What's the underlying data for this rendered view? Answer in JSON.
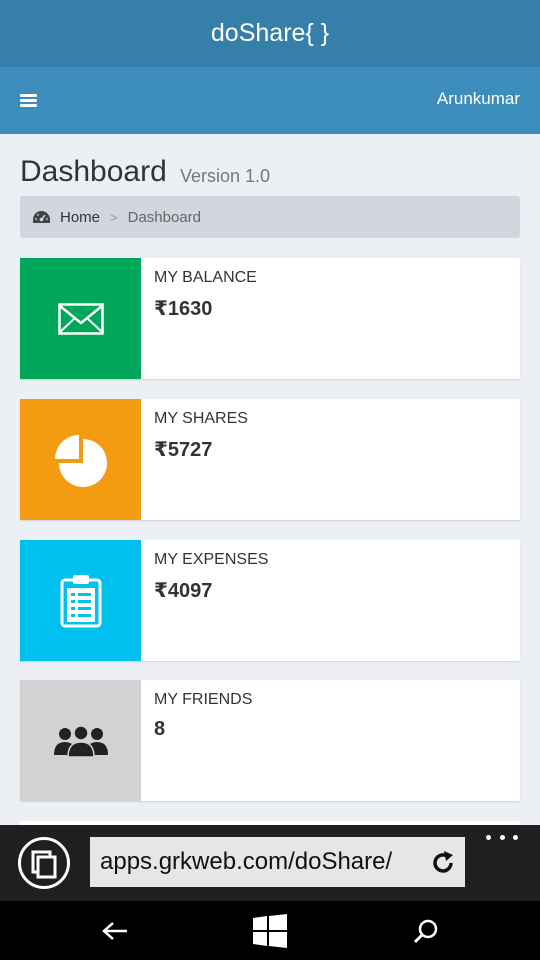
{
  "app": {
    "title": "doShare{ }"
  },
  "header": {
    "user_name": "Arunkumar",
    "menu_icon": "hamburger-icon"
  },
  "page": {
    "title": "Dashboard",
    "version": "Version 1.0"
  },
  "breadcrumb": {
    "icon": "dashboard-icon",
    "home": "Home",
    "separator": ">",
    "current": "Dashboard"
  },
  "boxes": [
    {
      "label": "MY BALANCE",
      "value": "₹1630",
      "icon": "envelope-icon",
      "color": "#00a65a"
    },
    {
      "label": "MY SHARES",
      "value": "₹5727",
      "icon": "pie-chart-icon",
      "color": "#f39c12"
    },
    {
      "label": "MY EXPENSES",
      "value": "₹4097",
      "icon": "clipboard-icon",
      "color": "#00c0ef"
    },
    {
      "label": "MY FRIENDS",
      "value": "8",
      "icon": "users-icon",
      "color": "#d2d2d2"
    }
  ],
  "browser": {
    "url": "apps.grkweb.com/doShare/",
    "tabs_icon": "tabs-icon",
    "reload_icon": "reload-icon",
    "more_icon": "more-icon"
  },
  "system_nav": {
    "back_icon": "back-arrow-icon",
    "start_icon": "windows-logo-icon",
    "search_icon": "search-icon"
  }
}
